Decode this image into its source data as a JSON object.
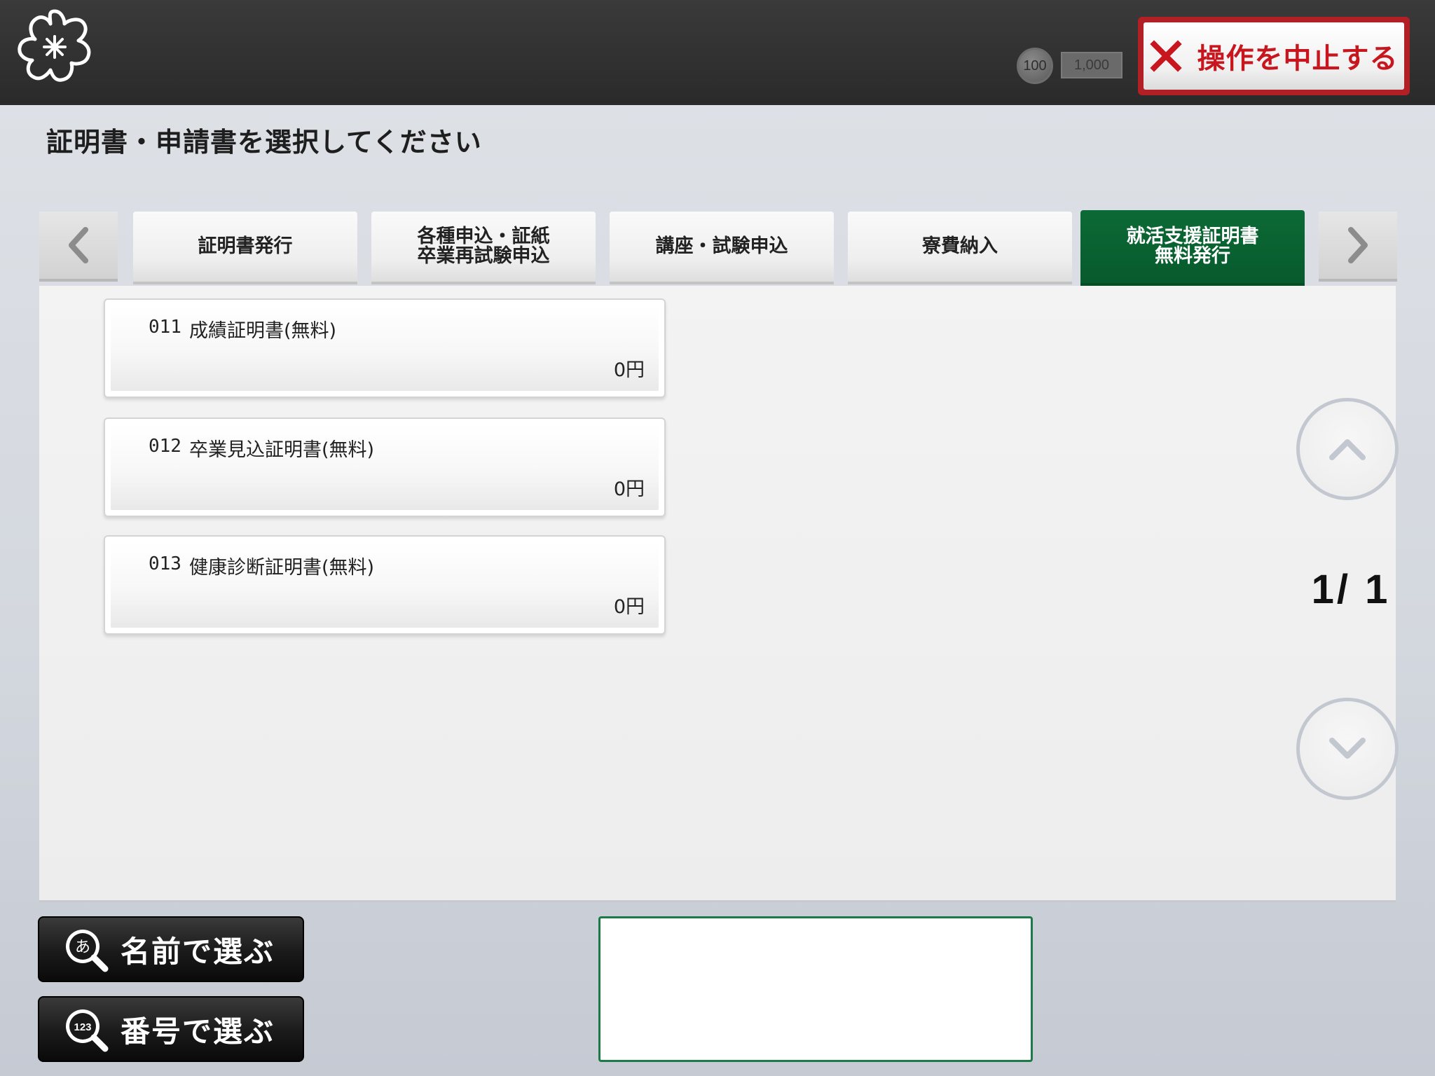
{
  "header": {
    "coin_label": "100",
    "bill_label": "1,000",
    "cancel_label": "操作を中止する"
  },
  "page": {
    "title": "証明書・申請書を選択してください"
  },
  "tabs": [
    {
      "line1": "証明書発行",
      "line2": ""
    },
    {
      "line1": "各種申込・証紙",
      "line2": "卒業再試験申込"
    },
    {
      "line1": "講座・試験申込",
      "line2": ""
    },
    {
      "line1": "寮費納入",
      "line2": ""
    },
    {
      "line1": "就活支援証明書",
      "line2": "無料発行"
    }
  ],
  "active_tab_index": 4,
  "items": [
    {
      "code": "011",
      "name": "成績証明書(無料)",
      "price": "0円"
    },
    {
      "code": "012",
      "name": "卒業見込証明書(無料)",
      "price": "0円"
    },
    {
      "code": "013",
      "name": "健康診断証明書(無料)",
      "price": "0円"
    }
  ],
  "pager": {
    "text": "1/ 1",
    "current": 1,
    "total": 1
  },
  "bottom": {
    "by_name_label": "名前で選ぶ",
    "by_number_label": "番号で選ぶ",
    "kana_icon_glyph": "あ",
    "number_icon_glyph": "123",
    "message": ""
  },
  "colors": {
    "active_tab": "#0c6a36",
    "cancel_red": "#c8161e",
    "header_bg": "#2e2e2e"
  },
  "icons": {
    "logo": "sakura-logo-icon",
    "cancel": "close-icon",
    "tab_prev": "chevron-left-icon",
    "tab_next": "chevron-right-icon",
    "scroll_up": "chevron-up-icon",
    "scroll_down": "chevron-down-icon",
    "by_name": "kana-search-icon",
    "by_number": "number-search-icon"
  }
}
